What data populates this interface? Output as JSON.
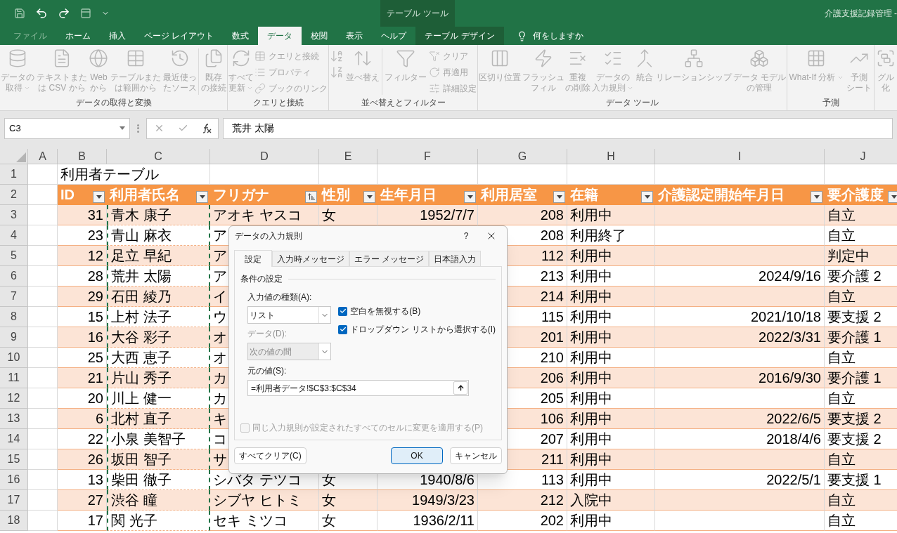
{
  "title_bar": {
    "context_label": "テーブル ツール",
    "document_title": "介護支援記録管理 -"
  },
  "tabs": [
    {
      "label": "ファイル",
      "selected": false,
      "kind": "file"
    },
    {
      "label": "ホーム",
      "selected": false,
      "kind": "tab"
    },
    {
      "label": "挿入",
      "selected": false,
      "kind": "tab"
    },
    {
      "label": "ページ レイアウト",
      "selected": false,
      "kind": "tab"
    },
    {
      "label": "数式",
      "selected": false,
      "kind": "tab"
    },
    {
      "label": "データ",
      "selected": true,
      "kind": "tab"
    },
    {
      "label": "校閲",
      "selected": false,
      "kind": "tab"
    },
    {
      "label": "表示",
      "selected": false,
      "kind": "tab"
    },
    {
      "label": "ヘルプ",
      "selected": false,
      "kind": "tab"
    },
    {
      "label": "テーブル デザイン",
      "selected": false,
      "kind": "context"
    }
  ],
  "tell_me": {
    "placeholder": "何をしますか"
  },
  "ribbon": {
    "disabled": true,
    "groups": [
      {
        "label": "データの取得と変換",
        "items": [
          {
            "kind": "large",
            "lines": [
              "データの",
              "取得"
            ],
            "dropdown": true
          },
          {
            "kind": "large",
            "lines": [
              "テキストまた",
              "は CSV から"
            ]
          },
          {
            "kind": "large",
            "lines": [
              "Web",
              "から"
            ]
          },
          {
            "kind": "large",
            "lines": [
              "テーブルまた",
              "は範囲から"
            ]
          },
          {
            "kind": "large",
            "lines": [
              "最近使っ",
              "たソース"
            ]
          },
          {
            "kind": "separator"
          },
          {
            "kind": "large",
            "lines": [
              "既存",
              "の接続"
            ]
          }
        ]
      },
      {
        "label": "クエリと接続",
        "items": [
          {
            "kind": "large",
            "lines": [
              "すべて",
              "更新"
            ],
            "dropdown": true
          },
          {
            "kind": "small",
            "lines": [
              "クエリと接続"
            ]
          },
          {
            "kind": "small",
            "lines": [
              "プロパティ"
            ]
          },
          {
            "kind": "small",
            "lines": [
              "ブックのリンク"
            ]
          }
        ]
      },
      {
        "label": "並べ替えとフィルター",
        "items": [
          {
            "kind": "icon"
          },
          {
            "kind": "icon"
          },
          {
            "kind": "large",
            "lines": [
              "並べ替え"
            ]
          },
          {
            "kind": "separator"
          },
          {
            "kind": "large",
            "lines": [
              "フィルター"
            ]
          },
          {
            "kind": "small",
            "lines": [
              "クリア"
            ]
          },
          {
            "kind": "small",
            "lines": [
              "再適用"
            ]
          },
          {
            "kind": "small",
            "lines": [
              "詳細設定"
            ]
          }
        ]
      },
      {
        "label": "データ ツール",
        "items": [
          {
            "kind": "large",
            "lines": [
              "区切り位置"
            ]
          },
          {
            "kind": "large",
            "lines": [
              "フラッシュ",
              "フィル"
            ]
          },
          {
            "kind": "large",
            "lines": [
              "重複",
              "の削除"
            ]
          },
          {
            "kind": "large",
            "lines": [
              "データの",
              "入力規則"
            ],
            "dropdown": true
          },
          {
            "kind": "large",
            "lines": [
              "統合"
            ]
          },
          {
            "kind": "large",
            "lines": [
              "リレーションシップ"
            ]
          },
          {
            "kind": "large",
            "lines": [
              "データ モデル",
              "の管理"
            ]
          }
        ]
      },
      {
        "label": "予測",
        "items": [
          {
            "kind": "large",
            "lines": [
              "What-If 分析"
            ],
            "dropdown": true
          },
          {
            "kind": "large",
            "lines": [
              "予測",
              "シート"
            ]
          }
        ]
      },
      {
        "items": [
          {
            "kind": "large",
            "lines": [
              "グル",
              "化"
            ]
          }
        ]
      }
    ]
  },
  "formula_bar": {
    "name_box": "C3",
    "formula": "荒井 太陽"
  },
  "sheet": {
    "column_headers": [
      "A",
      "B",
      "C",
      "D",
      "E",
      "F",
      "G",
      "H",
      "I",
      "J"
    ],
    "row_numbers": [
      "1",
      "2",
      "3",
      "4",
      "5",
      "6",
      "7",
      "8",
      "9",
      "10",
      "11",
      "12",
      "13",
      "14",
      "15",
      "16",
      "17",
      "18"
    ],
    "title": "利用者テーブル",
    "table": {
      "columns": [
        {
          "label": "ID",
          "kind": "filter"
        },
        {
          "label": "利用者氏名",
          "kind": "filter"
        },
        {
          "label": "フリガナ",
          "kind": "sorted"
        },
        {
          "label": "性別",
          "kind": "filter"
        },
        {
          "label": "生年月日",
          "kind": "filter"
        },
        {
          "label": "利用居室",
          "kind": "filter"
        },
        {
          "label": "在籍",
          "kind": "filter"
        },
        {
          "label": "介護認定開始年月日",
          "kind": "filter"
        },
        {
          "label": "要介護度",
          "kind": "filter"
        }
      ],
      "rows": [
        {
          "id": "31",
          "name": "青木 康子",
          "furigana": "アオキ ヤスコ",
          "gender": "女",
          "birth": "1952/7/7",
          "room": "208",
          "status": "利用中",
          "care_level": "自立"
        },
        {
          "id": "23",
          "name": "青山 麻衣",
          "furigana": "ア",
          "room": "208",
          "status": "利用終了",
          "care_level": "自立"
        },
        {
          "id": "12",
          "name": "足立 早紀",
          "furigana": "ア",
          "room": "112",
          "status": "利用中",
          "care_level": "判定中"
        },
        {
          "id": "28",
          "name": "荒井 太陽",
          "furigana": "ア",
          "room": "213",
          "status": "利用中",
          "cert_date": "2024/9/16",
          "care_level": "要介護 2"
        },
        {
          "id": "29",
          "name": "石田 綾乃",
          "furigana": "イ",
          "room": "214",
          "status": "利用中",
          "care_level": "自立"
        },
        {
          "id": "15",
          "name": "上村 法子",
          "furigana": "ウ",
          "room": "115",
          "status": "利用中",
          "cert_date": "2021/10/18",
          "care_level": "要支援 2"
        },
        {
          "id": "16",
          "name": "大谷 彩子",
          "furigana": "オ",
          "room": "201",
          "status": "利用中",
          "cert_date": "2022/3/31",
          "care_level": "要介護 1"
        },
        {
          "id": "25",
          "name": "大西 恵子",
          "furigana": "オ",
          "room": "210",
          "status": "利用中",
          "care_level": "自立"
        },
        {
          "id": "21",
          "name": "片山 秀子",
          "furigana": "カ",
          "room": "206",
          "status": "利用中",
          "cert_date": "2016/9/30",
          "care_level": "要介護 1"
        },
        {
          "id": "20",
          "name": "川上 健一",
          "furigana": "カ",
          "room": "205",
          "status": "利用中",
          "care_level": "自立"
        },
        {
          "id": "6",
          "name": "北村 直子",
          "furigana": "キ",
          "room": "106",
          "status": "利用中",
          "cert_date": "2022/6/5",
          "care_level": "要支援 2"
        },
        {
          "id": "22",
          "name": "小泉 美智子",
          "furigana": "コ",
          "room": "207",
          "status": "利用中",
          "cert_date": "2018/4/6",
          "care_level": "要支援 2"
        },
        {
          "id": "26",
          "name": "坂田 智子",
          "furigana": "サ",
          "room": "211",
          "status": "利用中",
          "care_level": "自立"
        },
        {
          "id": "13",
          "name": "柴田 徹子",
          "furigana": "シバタ テツコ",
          "gender": "女",
          "birth": "1940/8/6",
          "room": "113",
          "status": "利用中",
          "cert_date": "2022/5/1",
          "care_level": "要支援 1"
        },
        {
          "id": "27",
          "name": "渋谷 瞳",
          "furigana": "シブヤ ヒトミ",
          "gender": "女",
          "birth": "1949/3/23",
          "room": "212",
          "status": "入院中",
          "care_level": "自立"
        },
        {
          "id": "17",
          "name": "関 光子",
          "furigana": "セキ ミツコ",
          "gender": "女",
          "birth": "1936/2/11",
          "room": "202",
          "status": "利用中",
          "care_level": "自立"
        }
      ]
    }
  },
  "dialog": {
    "title": "データの入力規則",
    "help": "?",
    "tabs": [
      {
        "label": "設定",
        "selected": true
      },
      {
        "label": "入力時メッセージ",
        "selected": false
      },
      {
        "label": "エラー メッセージ",
        "selected": false
      },
      {
        "label": "日本語入力",
        "selected": false
      }
    ],
    "section": "条件の設定",
    "allow": {
      "label": "入力値の種類(A):",
      "value": "リスト"
    },
    "ignore_blank": {
      "label": "空白を無視する(B)",
      "checked": true
    },
    "in_cell_dropdown": {
      "label": "ドロップダウン リストから選択する(I)",
      "checked": true
    },
    "data": {
      "label": "データ(D):",
      "value": "次の値の間",
      "disabled": true
    },
    "source": {
      "label": "元の値(S):",
      "value": "=利用者データ!$C$3:$C$34"
    },
    "apply_all": {
      "label": "同じ入力規則が設定されたすべてのセルに変更を適用する(P)",
      "checked": false,
      "disabled": true
    },
    "buttons": [
      {
        "label": "すべてクリア(C)",
        "kind": "clear"
      },
      {
        "label": "OK",
        "kind": "ok"
      },
      {
        "label": "キャンセル",
        "kind": "cancel"
      }
    ]
  }
}
